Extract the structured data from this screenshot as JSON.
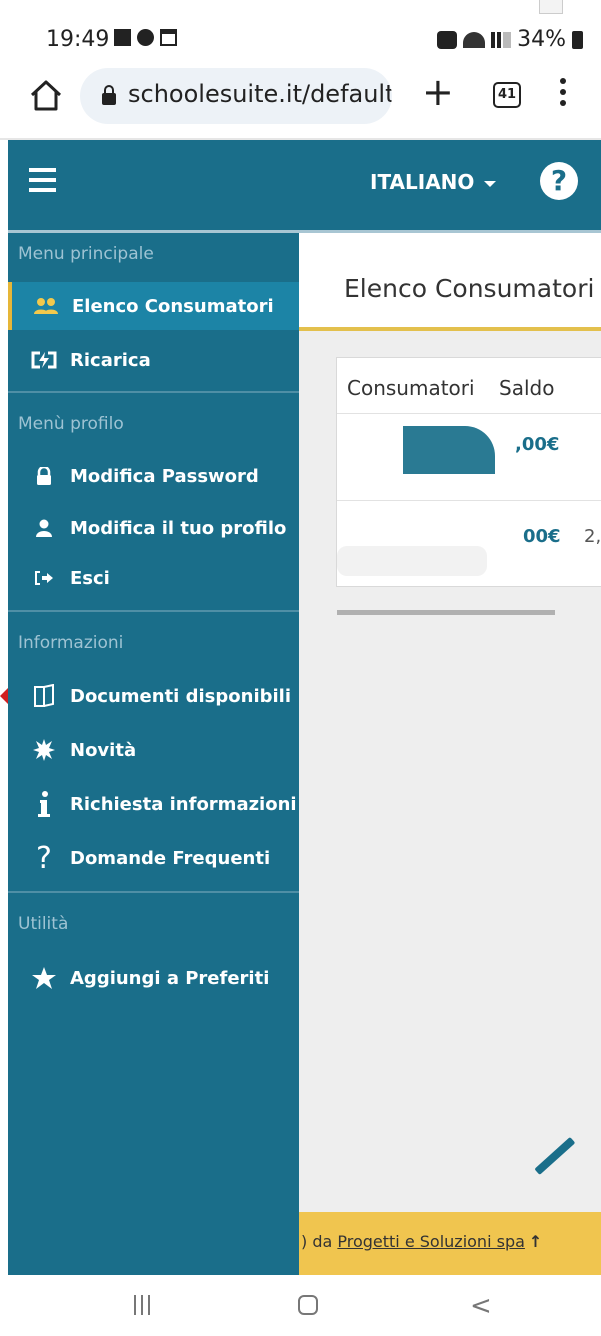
{
  "status_bar": {
    "time": "19:49",
    "battery": "34%"
  },
  "browser": {
    "url": "schoolesuite.it/default",
    "tab_count": "41"
  },
  "header": {
    "language": "ITALIANO",
    "help_glyph": "?"
  },
  "sidebar": {
    "sections": [
      {
        "title": "Menu principale"
      },
      {
        "title": "Menù profilo"
      },
      {
        "title": "Informazioni"
      },
      {
        "title": "Utilità"
      }
    ],
    "items": [
      {
        "label": "Elenco Consumatori",
        "icon": "users-icon",
        "active": true
      },
      {
        "label": "Ricarica",
        "icon": "recharge-icon"
      },
      {
        "label": "Modifica Password",
        "icon": "lock-icon"
      },
      {
        "label": "Modifica il tuo profilo",
        "icon": "user-icon"
      },
      {
        "label": "Esci",
        "icon": "logout-icon"
      },
      {
        "label": "Documenti disponibili",
        "icon": "documents-icon"
      },
      {
        "label": "Novità",
        "icon": "news-icon"
      },
      {
        "label": "Richiesta informazioni",
        "icon": "info-icon"
      },
      {
        "label": "Domande Frequenti",
        "icon": "question-icon"
      },
      {
        "label": "Aggiungi a Preferiti",
        "icon": "star-icon"
      }
    ]
  },
  "main": {
    "title": "Elenco Consumatori",
    "table": {
      "headers": [
        "Consumatori",
        "Saldo"
      ],
      "rows": [
        {
          "saldo": ",00€",
          "extra": ""
        },
        {
          "saldo": "00€",
          "extra": "2,"
        }
      ]
    },
    "footer": {
      "prefix": ") da ",
      "link": "Progetti e Soluzioni spa",
      "arrow": "↑"
    }
  },
  "colors": {
    "brand": "#1a6e8a",
    "accent": "#f0c54f",
    "active_item": "#1c84a6"
  }
}
